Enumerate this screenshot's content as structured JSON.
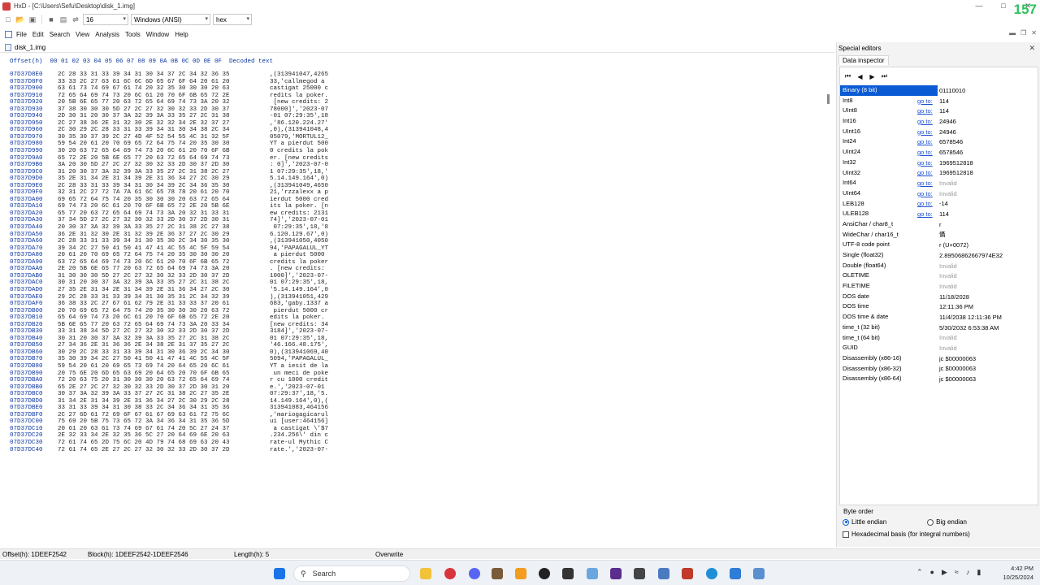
{
  "window": {
    "title": "HxD - [C:\\Users\\Sefu\\Desktop\\disk_1.img]",
    "overlay_number": "157"
  },
  "toolbar": {
    "bytes_per_row": "16",
    "charset": "Windows (ANSI)",
    "offset_base": "hex"
  },
  "menu": [
    "File",
    "Edit",
    "Search",
    "View",
    "Analysis",
    "Tools",
    "Window",
    "Help"
  ],
  "tab": {
    "filename": "disk_1.img"
  },
  "hex": {
    "header": "Offset(h)  00 01 02 03 04 05 06 07 08 09 0A 0B 0C 0D 0E 0F  Decoded text",
    "rows": [
      {
        "o": "07D37D8E0",
        "h": "2C 28 33 31 33 39 34 31 30 34 37 2C 34 32 36 35",
        "d": ",(313941047,4265"
      },
      {
        "o": "07D37D8F0",
        "h": "33 33 2C 27 63 61 6C 6C 6D 65 67 6F 64 20 61 20",
        "d": "33,'callmegod a "
      },
      {
        "o": "07D37D900",
        "h": "63 61 73 74 69 67 61 74 20 32 35 30 30 30 20 63",
        "d": "castigat 25000 c"
      },
      {
        "o": "07D37D910",
        "h": "72 65 64 69 74 73 20 6C 61 20 70 6F 6B 65 72 2E",
        "d": "redits la poker."
      },
      {
        "o": "07D37D920",
        "h": "20 5B 6E 65 77 20 63 72 65 64 69 74 73 3A 20 32",
        "d": " [new credits: 2"
      },
      {
        "o": "07D37D930",
        "h": "37 38 30 30 30 5D 27 2C 27 32 30 32 33 2D 30 37",
        "d": "78000]','2023-07"
      },
      {
        "o": "07D37D940",
        "h": "2D 30 31 20 30 37 3A 32 39 3A 33 35 27 2C 31 38",
        "d": "-01 07:29:35',18"
      },
      {
        "o": "07D37D950",
        "h": "2C 27 38 36 2E 31 32 30 2E 32 32 34 2E 32 37 27",
        "d": ",'86.120.224.27'"
      },
      {
        "o": "07D37D960",
        "h": "2C 30 29 2C 28 33 31 33 39 34 31 30 34 38 2C 34",
        "d": ",0),(313941048,4"
      },
      {
        "o": "07D37D970",
        "h": "30 35 30 37 39 2C 27 4D 4F 52 54 55 4C 31 32 5F",
        "d": "05079,'MORTUL12_"
      },
      {
        "o": "07D37D980",
        "h": "59 54 20 61 20 70 69 65 72 64 75 74 20 35 30 30",
        "d": "YT a pierdut 500"
      },
      {
        "o": "07D37D990",
        "h": "30 20 63 72 65 64 69 74 73 20 6C 61 20 70 6F 6B",
        "d": "0 credits la pok"
      },
      {
        "o": "07D37D9A0",
        "h": "65 72 2E 20 5B 6E 65 77 20 63 72 65 64 69 74 73",
        "d": "er. [new credits"
      },
      {
        "o": "07D37D9B0",
        "h": "3A 20 30 5D 27 2C 27 32 30 32 33 2D 30 37 2D 30",
        "d": ": 0]','2023-07-0"
      },
      {
        "o": "07D37D9C0",
        "h": "31 20 30 37 3A 32 39 3A 33 35 27 2C 31 38 2C 27",
        "d": "1 07:29:35',18,'"
      },
      {
        "o": "07D37D9D0",
        "h": "35 2E 31 34 2E 31 34 39 2E 31 36 34 27 2C 30 29",
        "d": "5.14.149.164',0)"
      },
      {
        "o": "07D37D9E0",
        "h": "2C 28 33 31 33 39 34 31 30 34 39 2C 34 36 35 30",
        "d": ",(313941049,4650"
      },
      {
        "o": "07D37D9F0",
        "h": "32 31 2C 27 72 7A 7A 61 6C 65 78 78 20 61 20 70",
        "d": "21,'rzzalexx a p"
      },
      {
        "o": "07D37DA00",
        "h": "69 65 72 64 75 74 20 35 30 30 30 20 63 72 65 64",
        "d": "ierdut 5000 cred"
      },
      {
        "o": "07D37DA10",
        "h": "69 74 73 20 6C 61 20 70 6F 6B 65 72 2E 20 5B 6E",
        "d": "its la poker. [n"
      },
      {
        "o": "07D37DA20",
        "h": "65 77 20 63 72 65 64 69 74 73 3A 20 32 31 33 31",
        "d": "ew credits: 2131"
      },
      {
        "o": "07D37DA30",
        "h": "37 34 5D 27 2C 27 32 30 32 33 2D 30 37 2D 30 31",
        "d": "74]','2023-07-01"
      },
      {
        "o": "07D37DA40",
        "h": "20 30 37 3A 32 39 3A 33 35 27 2C 31 38 2C 27 38",
        "d": " 07:29:35',18,'8"
      },
      {
        "o": "07D37DA50",
        "h": "36 2E 31 32 30 2E 31 32 39 2E 36 37 27 2C 30 29",
        "d": "6.120.129.67',0)"
      },
      {
        "o": "07D37DA60",
        "h": "2C 28 33 31 33 39 34 31 30 35 30 2C 34 30 35 30",
        "d": ",(313941050,4050"
      },
      {
        "o": "07D37DA70",
        "h": "39 34 2C 27 50 41 50 41 47 41 4C 55 4C 5F 59 54",
        "d": "94,'PAPAGALUL_YT"
      },
      {
        "o": "07D37DA80",
        "h": "20 61 20 70 69 65 72 64 75 74 20 35 30 30 30 20",
        "d": " a pierdut 5000 "
      },
      {
        "o": "07D37DA90",
        "h": "63 72 65 64 69 74 73 20 6C 61 20 70 6F 6B 65 72",
        "d": "credits la poker"
      },
      {
        "o": "07D37DAA0",
        "h": "2E 20 5B 6E 65 77 20 63 72 65 64 69 74 73 3A 20",
        "d": ". [new credits: "
      },
      {
        "o": "07D37DAB0",
        "h": "31 30 30 30 5D 27 2C 27 32 30 32 33 2D 30 37 2D",
        "d": "1000]','2023-07-"
      },
      {
        "o": "07D37DAC0",
        "h": "30 31 20 30 37 3A 32 39 3A 33 35 27 2C 31 38 2C",
        "d": "01 07:29:35',18,"
      },
      {
        "o": "07D37DAD0",
        "h": "27 35 2E 31 34 2E 31 34 39 2E 31 36 34 27 2C 30",
        "d": "'5.14.149.164',0"
      },
      {
        "o": "07D37DAE0",
        "h": "29 2C 28 33 31 33 39 34 31 30 35 31 2C 34 32 39",
        "d": "),(313941051,429"
      },
      {
        "o": "07D37DAF0",
        "h": "36 38 33 2C 27 67 61 62 79 2E 31 33 33 37 20 61",
        "d": "683,'gaby.1337 a"
      },
      {
        "o": "07D37DB00",
        "h": "20 70 69 65 72 64 75 74 20 35 30 30 30 20 63 72",
        "d": " pierdut 5000 cr"
      },
      {
        "o": "07D37DB10",
        "h": "65 64 69 74 73 20 6C 61 20 70 6F 6B 65 72 2E 20",
        "d": "edits la poker. "
      },
      {
        "o": "07D37DB20",
        "h": "5B 6E 65 77 20 63 72 65 64 69 74 73 3A 20 33 34",
        "d": "[new credits: 34"
      },
      {
        "o": "07D37DB30",
        "h": "33 31 38 34 5D 27 2C 27 32 30 32 33 2D 30 37 2D",
        "d": "3184]','2023-07-"
      },
      {
        "o": "07D37DB40",
        "h": "30 31 20 30 37 3A 32 39 3A 33 35 27 2C 31 38 2C",
        "d": "01 07:29:35',18,"
      },
      {
        "o": "07D37DB50",
        "h": "27 34 36 2E 31 36 36 2E 34 38 2E 31 37 35 27 2C",
        "d": "'46.166.48.175',"
      },
      {
        "o": "07D37DB60",
        "h": "30 29 2C 28 33 31 33 39 34 31 30 36 39 2C 34 30",
        "d": "0),(313941069,40"
      },
      {
        "o": "07D37DB70",
        "h": "35 30 39 34 2C 27 50 41 50 41 47 41 4C 55 4C 5F",
        "d": "5094,'PAPAGALUL_"
      },
      {
        "o": "07D37DB80",
        "h": "59 54 20 61 20 69 65 73 69 74 20 64 65 20 6C 61",
        "d": "YT a iesit de la"
      },
      {
        "o": "07D37DB90",
        "h": "20 75 6E 20 6D 65 63 69 20 64 65 20 70 6F 6B 65",
        "d": " un meci de poke"
      },
      {
        "o": "07D37DBA0",
        "h": "72 20 63 75 20 31 30 30 30 20 63 72 65 64 69 74",
        "d": "r cu 1000 credit"
      },
      {
        "o": "07D37DBB0",
        "h": "65 2E 27 2C 27 32 30 32 33 2D 30 37 2D 30 31 20",
        "d": "e.','2023-07-01 "
      },
      {
        "o": "07D37DBC0",
        "h": "30 37 3A 32 39 3A 33 37 27 2C 31 38 2C 27 35 2E",
        "d": "07:29:37',18,'5."
      },
      {
        "o": "07D37DBD0",
        "h": "31 34 2E 31 34 39 2E 31 36 34 27 2C 30 29 2C 28",
        "d": "14.149.164',0),("
      },
      {
        "o": "07D37DBE0",
        "h": "33 31 33 39 34 31 30 38 33 2C 34 36 34 31 35 36",
        "d": "313941083,464156"
      },
      {
        "o": "07D37DBF0",
        "h": "2C 27 6D 61 72 69 6F 67 61 67 69 63 61 72 75 6C",
        "d": ",'mariogagicarul"
      },
      {
        "o": "07D37DC00",
        "h": "75 69 20 5B 75 73 65 72 3A 34 36 34 31 35 36 5D",
        "d": "ui [user:464156]"
      },
      {
        "o": "07D37DC10",
        "h": "20 61 20 63 61 73 74 69 67 61 74 20 5C 27 24 37",
        "d": " a castigat \\'$7"
      },
      {
        "o": "07D37DC20",
        "h": "2E 32 33 34 2E 32 35 36 5C 27 20 64 69 6E 20 63",
        "d": ".234.256\\' din c"
      },
      {
        "o": "07D37DC30",
        "h": "72 61 74 65 2D 75 6C 20 4D 79 74 68 69 63 20 43",
        "d": "rate-ul Mythic C"
      },
      {
        "o": "07D37DC40",
        "h": "72 61 74 65 2E 27 2C 27 32 30 32 33 2D 30 37 2D",
        "d": "rate.','2023-07-"
      }
    ]
  },
  "special_editors": {
    "title": "Special editors",
    "tab": "Data inspector",
    "goto_label": "go to:",
    "rows": [
      {
        "name": "Binary (8 bit)",
        "value": "01110010",
        "goto": false,
        "selected": true,
        "invalid": false
      },
      {
        "name": "Int8",
        "value": "114",
        "goto": true,
        "selected": false,
        "invalid": false
      },
      {
        "name": "UInt8",
        "value": "114",
        "goto": true,
        "selected": false,
        "invalid": false
      },
      {
        "name": "Int16",
        "value": "24946",
        "goto": true,
        "selected": false,
        "invalid": false
      },
      {
        "name": "UInt16",
        "value": "24946",
        "goto": true,
        "selected": false,
        "invalid": false
      },
      {
        "name": "Int24",
        "value": "6578546",
        "goto": true,
        "selected": false,
        "invalid": false
      },
      {
        "name": "UInt24",
        "value": "6578546",
        "goto": true,
        "selected": false,
        "invalid": false
      },
      {
        "name": "Int32",
        "value": "1969512818",
        "goto": true,
        "selected": false,
        "invalid": false
      },
      {
        "name": "UInt32",
        "value": "1969512818",
        "goto": true,
        "selected": false,
        "invalid": false
      },
      {
        "name": "Int64",
        "value": "Invalid",
        "goto": true,
        "selected": false,
        "invalid": true
      },
      {
        "name": "UInt64",
        "value": "Invalid",
        "goto": true,
        "selected": false,
        "invalid": true
      },
      {
        "name": "LEB128",
        "value": "-14",
        "goto": true,
        "selected": false,
        "invalid": false
      },
      {
        "name": "ULEB128",
        "value": "114",
        "goto": true,
        "selected": false,
        "invalid": false
      },
      {
        "name": "AnsiChar / char8_t",
        "value": "r",
        "goto": false,
        "selected": false,
        "invalid": false
      },
      {
        "name": "WideChar / char16_t",
        "value": "慲",
        "goto": false,
        "selected": false,
        "invalid": false
      },
      {
        "name": "UTF-8 code point",
        "value": "r (U+0072)",
        "goto": false,
        "selected": false,
        "invalid": false
      },
      {
        "name": "Single (float32)",
        "value": "2.89506862667974E32",
        "goto": false,
        "selected": false,
        "invalid": false
      },
      {
        "name": "Double (float64)",
        "value": "Invalid",
        "goto": false,
        "selected": false,
        "invalid": true
      },
      {
        "name": "OLETIME",
        "value": "Invalid",
        "goto": false,
        "selected": false,
        "invalid": true
      },
      {
        "name": "FILETIME",
        "value": "Invalid",
        "goto": false,
        "selected": false,
        "invalid": true
      },
      {
        "name": "DOS date",
        "value": "11/18/2028",
        "goto": false,
        "selected": false,
        "invalid": false
      },
      {
        "name": "DOS time",
        "value": "12:11:36 PM",
        "goto": false,
        "selected": false,
        "invalid": false
      },
      {
        "name": "DOS time & date",
        "value": "11/4/2038 12:11:36 PM",
        "goto": false,
        "selected": false,
        "invalid": false
      },
      {
        "name": "time_t (32 bit)",
        "value": "5/30/2032 6:53:38 AM",
        "goto": false,
        "selected": false,
        "invalid": false
      },
      {
        "name": "time_t (64 bit)",
        "value": "Invalid",
        "goto": false,
        "selected": false,
        "invalid": true
      },
      {
        "name": "GUID",
        "value": "Invalid",
        "goto": false,
        "selected": false,
        "invalid": true
      },
      {
        "name": "Disassembly (x86-16)",
        "value": "jc $00000063",
        "goto": false,
        "selected": false,
        "invalid": false
      },
      {
        "name": "Disassembly (x86-32)",
        "value": "jc $00000063",
        "goto": false,
        "selected": false,
        "invalid": false
      },
      {
        "name": "Disassembly (x86-64)",
        "value": "jc $00000063",
        "goto": false,
        "selected": false,
        "invalid": false
      }
    ],
    "byte_order": {
      "legend": "Byte order",
      "little": "Little endian",
      "big": "Big endian",
      "selected": "little",
      "hex_basis": "Hexadecimal basis (for integral numbers)"
    }
  },
  "status": {
    "offset": "Offset(h): 1DEEF2542",
    "block": "Block(h): 1DEEF2542-1DEEF2546",
    "length": "Length(h): 5",
    "mode": "Overwrite"
  },
  "taskbar": {
    "search_placeholder": "Search",
    "time": "4:42 PM",
    "date": "10/25/2024"
  },
  "colors": {
    "offset_blue": "#0a35a0",
    "selection": "#0a5bd3",
    "overlay_green": "#2fc15f"
  }
}
